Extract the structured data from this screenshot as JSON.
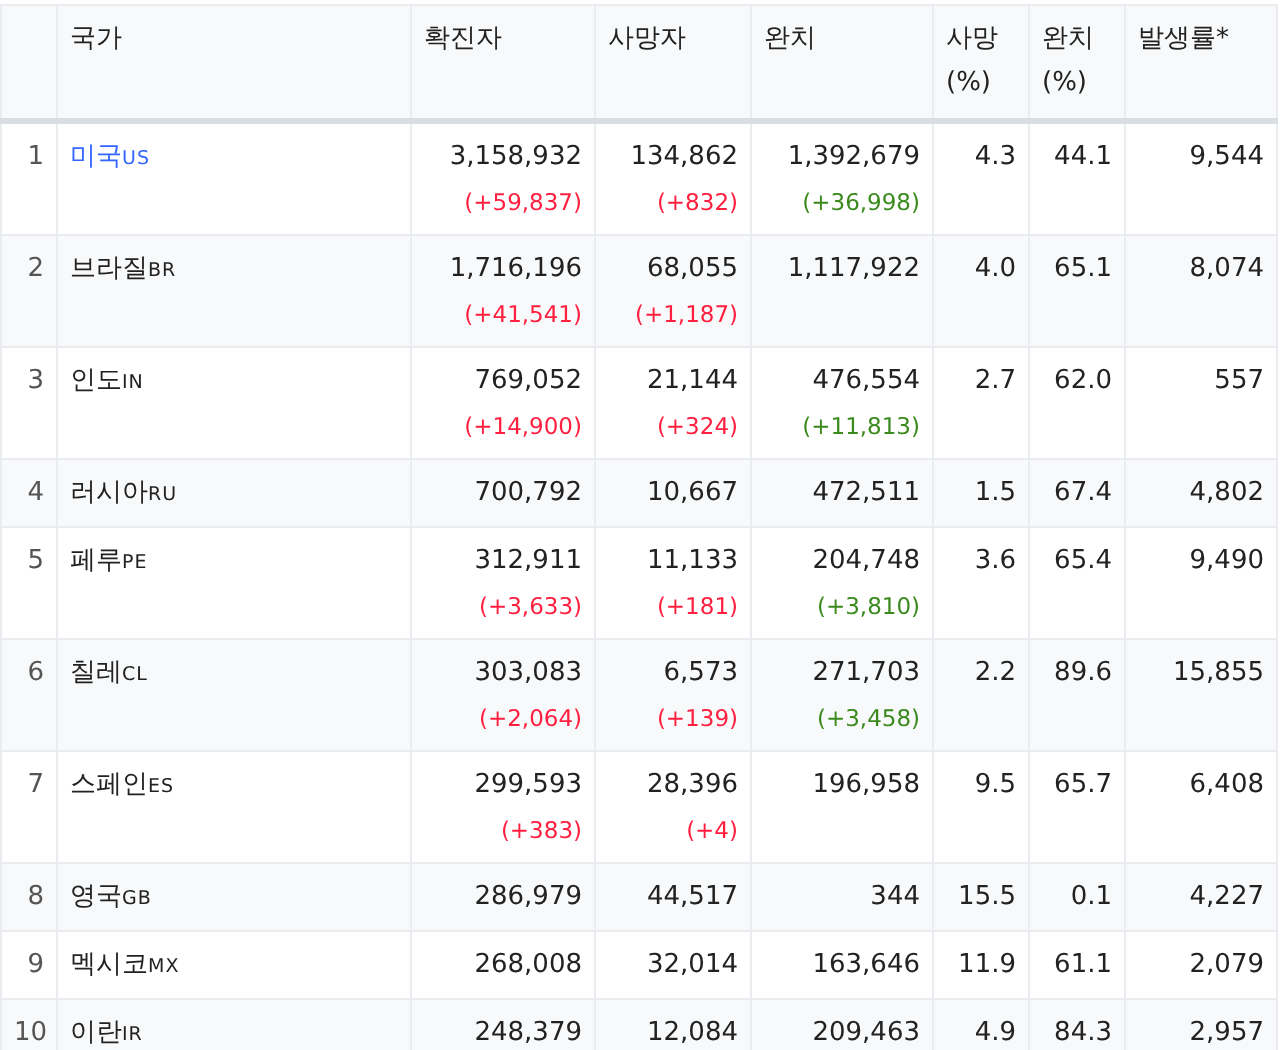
{
  "table": {
    "columns": [
      "국가",
      "확진자",
      "사망자",
      "완치",
      "사망 (%)",
      "완치 (%)",
      "발생률*"
    ],
    "rows": [
      {
        "rank": "1",
        "country": "미국",
        "code": "US",
        "linked": true,
        "confirmed": "3,158,932",
        "confirmed_delta": "(+59,837)",
        "deaths": "134,862",
        "deaths_delta": "(+832)",
        "recovered": "1,392,679",
        "recovered_delta": "(+36,998)",
        "death_rate": "4.3",
        "recovery_rate": "44.1",
        "incidence": "9,544"
      },
      {
        "rank": "2",
        "country": "브라질",
        "code": "BR",
        "linked": false,
        "confirmed": "1,716,196",
        "confirmed_delta": "(+41,541)",
        "deaths": "68,055",
        "deaths_delta": "(+1,187)",
        "recovered": "1,117,922",
        "death_rate": "4.0",
        "recovery_rate": "65.1",
        "incidence": "8,074"
      },
      {
        "rank": "3",
        "country": "인도",
        "code": "IN",
        "linked": false,
        "confirmed": "769,052",
        "confirmed_delta": "(+14,900)",
        "deaths": "21,144",
        "deaths_delta": "(+324)",
        "recovered": "476,554",
        "recovered_delta": "(+11,813)",
        "death_rate": "2.7",
        "recovery_rate": "62.0",
        "incidence": "557"
      },
      {
        "rank": "4",
        "country": "러시아",
        "code": "RU",
        "linked": false,
        "confirmed": "700,792",
        "deaths": "10,667",
        "recovered": "472,511",
        "death_rate": "1.5",
        "recovery_rate": "67.4",
        "incidence": "4,802"
      },
      {
        "rank": "5",
        "country": "페루",
        "code": "PE",
        "linked": false,
        "confirmed": "312,911",
        "confirmed_delta": "(+3,633)",
        "deaths": "11,133",
        "deaths_delta": "(+181)",
        "recovered": "204,748",
        "recovered_delta": "(+3,810)",
        "death_rate": "3.6",
        "recovery_rate": "65.4",
        "incidence": "9,490"
      },
      {
        "rank": "6",
        "country": "칠레",
        "code": "CL",
        "linked": false,
        "confirmed": "303,083",
        "confirmed_delta": "(+2,064)",
        "deaths": "6,573",
        "deaths_delta": "(+139)",
        "recovered": "271,703",
        "recovered_delta": "(+3,458)",
        "death_rate": "2.2",
        "recovery_rate": "89.6",
        "incidence": "15,855"
      },
      {
        "rank": "7",
        "country": "스페인",
        "code": "ES",
        "linked": false,
        "confirmed": "299,593",
        "confirmed_delta": "(+383)",
        "deaths": "28,396",
        "deaths_delta": "(+4)",
        "recovered": "196,958",
        "death_rate": "9.5",
        "recovery_rate": "65.7",
        "incidence": "6,408"
      },
      {
        "rank": "8",
        "country": "영국",
        "code": "GB",
        "linked": false,
        "confirmed": "286,979",
        "deaths": "44,517",
        "recovered": "344",
        "death_rate": "15.5",
        "recovery_rate": "0.1",
        "incidence": "4,227"
      },
      {
        "rank": "9",
        "country": "멕시코",
        "code": "MX",
        "linked": false,
        "confirmed": "268,008",
        "deaths": "32,014",
        "recovered": "163,646",
        "death_rate": "11.9",
        "recovery_rate": "61.1",
        "incidence": "2,079"
      },
      {
        "rank": "10",
        "country": "이란",
        "code": "IR",
        "linked": false,
        "confirmed": "248,379",
        "deaths": "12,084",
        "recovered": "209,463",
        "death_rate": "4.9",
        "recovery_rate": "84.3",
        "incidence": "2,957"
      }
    ]
  }
}
